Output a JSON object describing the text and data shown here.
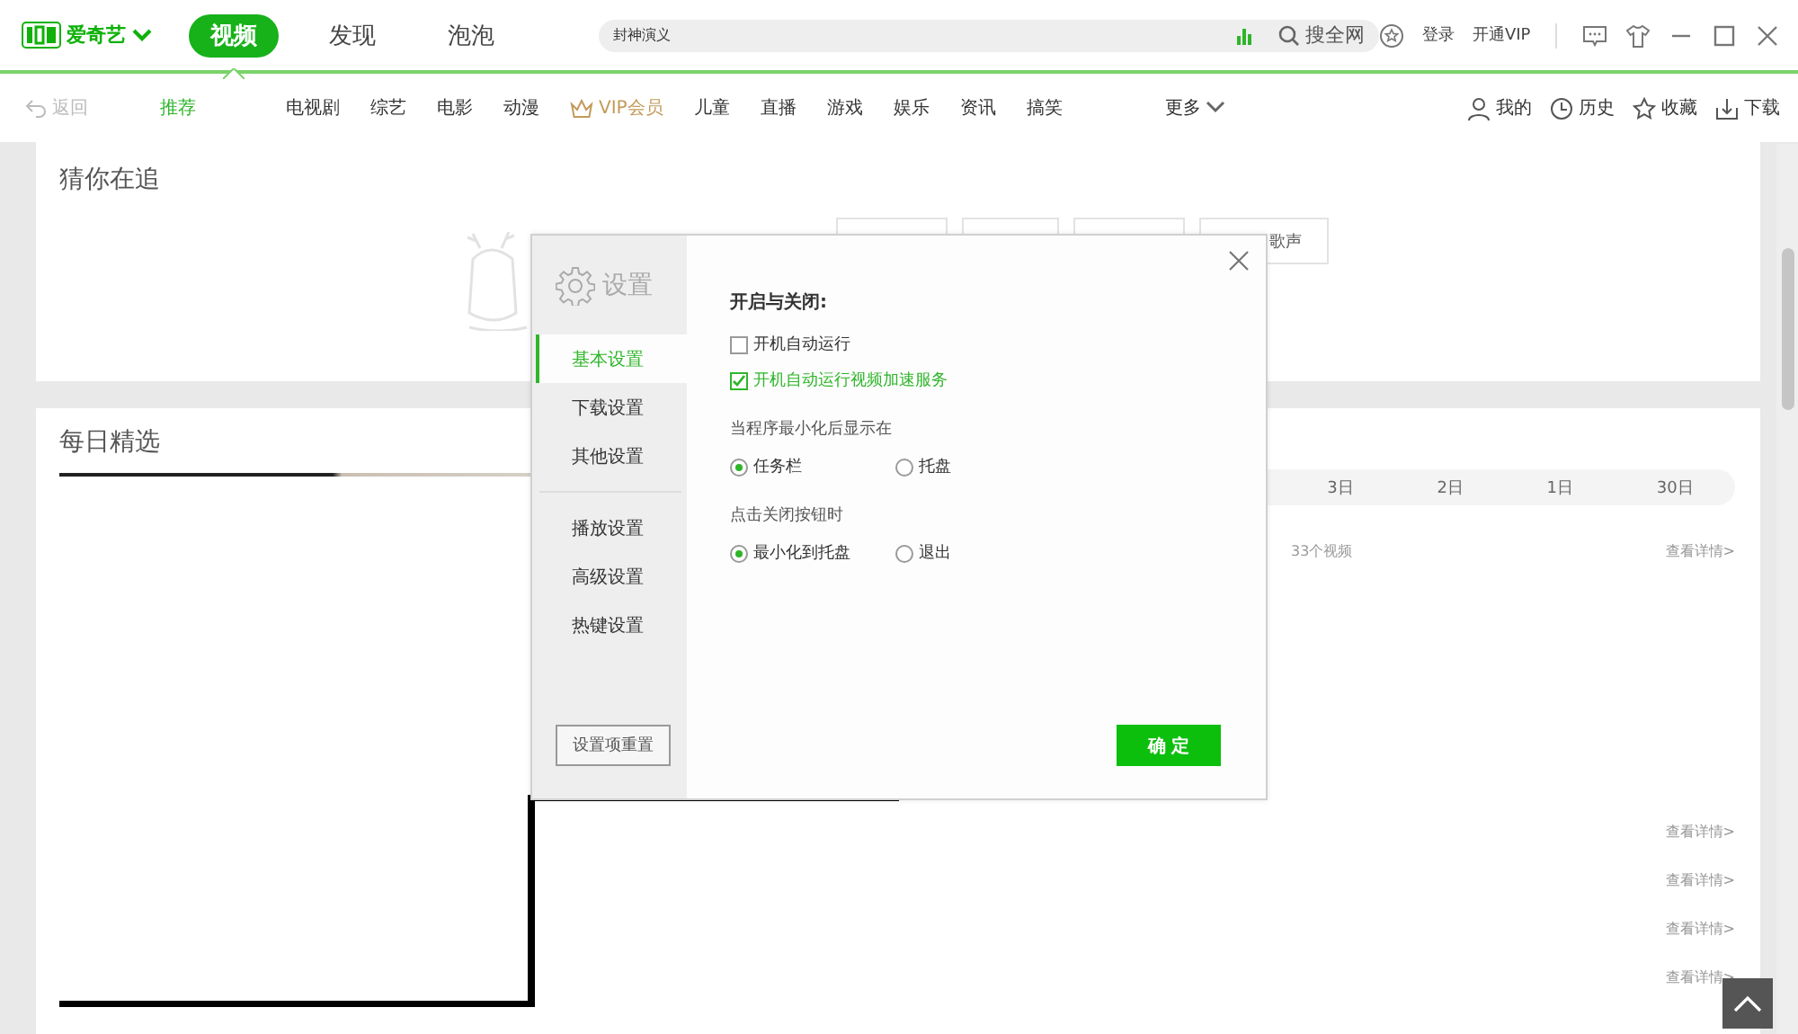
{
  "top_bar": {
    "brand": "爱奇艺",
    "tabs": [
      {
        "label": "视频",
        "selected": true
      },
      {
        "label": "发现",
        "selected": false
      },
      {
        "label": "泡泡",
        "selected": false
      }
    ],
    "search": {
      "value": "封神演义",
      "button": "搜全网"
    },
    "login": "登录",
    "vip": "开通VIP"
  },
  "nav": {
    "back": "返回",
    "items": [
      {
        "label": "推荐",
        "selected": true,
        "kind": "plain"
      },
      {
        "label": "电视剧",
        "selected": false,
        "kind": "plain"
      },
      {
        "label": "综艺",
        "selected": false,
        "kind": "plain"
      },
      {
        "label": "电影",
        "selected": false,
        "kind": "plain"
      },
      {
        "label": "动漫",
        "selected": false,
        "kind": "plain"
      },
      {
        "label": "VIP会员",
        "selected": false,
        "kind": "vip"
      },
      {
        "label": "儿童",
        "selected": false,
        "kind": "plain"
      },
      {
        "label": "直播",
        "selected": false,
        "kind": "plain"
      },
      {
        "label": "游戏",
        "selected": false,
        "kind": "plain"
      },
      {
        "label": "娱乐",
        "selected": false,
        "kind": "plain"
      },
      {
        "label": "资讯",
        "selected": false,
        "kind": "plain"
      },
      {
        "label": "搞笑",
        "selected": false,
        "kind": "plain"
      }
    ],
    "more": "更多",
    "actions": [
      {
        "label": "我的",
        "kind": "user"
      },
      {
        "label": "历史",
        "kind": "clock"
      },
      {
        "label": "收藏",
        "kind": "star"
      },
      {
        "label": "下载",
        "kind": "download"
      }
    ]
  },
  "following": {
    "title": "猜你在追",
    "tags": [
      {
        "kind": "blank"
      },
      {
        "kind": "blank"
      },
      {
        "kind": "blank"
      },
      {
        "kind": "text",
        "text": "歌声"
      }
    ]
  },
  "daily": {
    "title": "每日精选",
    "date_tabs": [
      "3日",
      "2日",
      "1日",
      "30日"
    ],
    "rows": [
      {
        "count": "33个视频",
        "link": "查看详情>"
      },
      {
        "link": "查看详情>"
      },
      {
        "link": "查看详情>"
      },
      {
        "link": "查看详情>"
      },
      {
        "link": "查看详情>"
      }
    ]
  },
  "dialog": {
    "title": "设置",
    "menu_groups": [
      {
        "items": [
          {
            "label": "基本设置",
            "selected": true
          },
          {
            "label": "下载设置",
            "selected": false
          },
          {
            "label": "其他设置",
            "selected": false
          }
        ]
      },
      {
        "items": [
          {
            "label": "播放设置",
            "selected": false
          },
          {
            "label": "高级设置",
            "selected": false
          },
          {
            "label": "热键设置",
            "selected": false
          }
        ]
      }
    ],
    "reset": "设置项重置",
    "section": "开启与关闭:",
    "checkboxes": [
      {
        "label": "开机自动运行",
        "checked": false
      },
      {
        "label": "开机自动运行视频加速服务",
        "checked": true
      }
    ],
    "radio_groups": [
      {
        "label": "当程序最小化后显示在",
        "options": [
          {
            "label": "任务栏",
            "selected": true
          },
          {
            "label": "托盘",
            "selected": false
          }
        ]
      },
      {
        "label": "点击关闭按钮时",
        "options": [
          {
            "label": "最小化到托盘",
            "selected": true
          },
          {
            "label": "退出",
            "selected": false
          }
        ]
      }
    ],
    "confirm": "确 定"
  }
}
